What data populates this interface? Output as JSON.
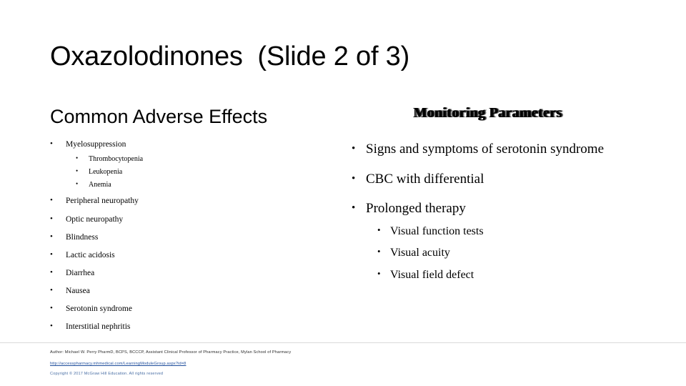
{
  "slide": {
    "title": "Oxazolodinones  (Slide 2 of 3)",
    "bullet_glyph": "•"
  },
  "left_column": {
    "heading": "Common Adverse Effects",
    "items": [
      {
        "level": 1,
        "label": "Myelosuppression"
      },
      {
        "level": 2,
        "label": "Thrombocytopenia"
      },
      {
        "level": 2,
        "label": "Leukopenia"
      },
      {
        "level": 2,
        "label": "Anemia"
      },
      {
        "level": 1,
        "label": "Peripheral neuropathy"
      },
      {
        "level": 1,
        "label": "Optic neuropathy"
      },
      {
        "level": 1,
        "label": "Blindness"
      },
      {
        "level": 1,
        "label": "Lactic acidosis"
      },
      {
        "level": 1,
        "label": "Diarrhea"
      },
      {
        "level": 1,
        "label": "Nausea"
      },
      {
        "level": 1,
        "label": "Serotonin syndrome"
      },
      {
        "level": 1,
        "label": "Interstitial nephritis"
      }
    ]
  },
  "right_column": {
    "heading": "Monitoring Parameters",
    "items": [
      {
        "level": 1,
        "label": "Signs and symptoms of serotonin syndrome"
      },
      {
        "level": 1,
        "label": "CBC with differential"
      },
      {
        "level": 1,
        "label": "Prolonged therapy"
      },
      {
        "level": 2,
        "label": "Visual function tests"
      },
      {
        "level": 2,
        "label": "Visual acuity"
      },
      {
        "level": 2,
        "label": "Visual field defect"
      }
    ]
  },
  "footer": {
    "author": "Author: Michael W. Perry PharmD, BCPS, BCCCP, Assistant Clinical Professor of Pharmacy Practice, Mylan School of Pharmacy",
    "link": "http://accesspharmacy.mhmedical.com/LearningModuleGroup.aspx?id=8",
    "copyright": "Copyright © 2017 McGraw Hill Education. All rights reserved"
  },
  "layout": {
    "left_level1_tops": [
      196,
      275,
      301,
      326,
      351,
      376,
      401,
      426,
      451
    ],
    "left_level2_tops": [
      217,
      235,
      253
    ],
    "right_level1_tops": [
      198,
      240,
      281
    ],
    "right_level2_tops": [
      315,
      345,
      376
    ]
  }
}
